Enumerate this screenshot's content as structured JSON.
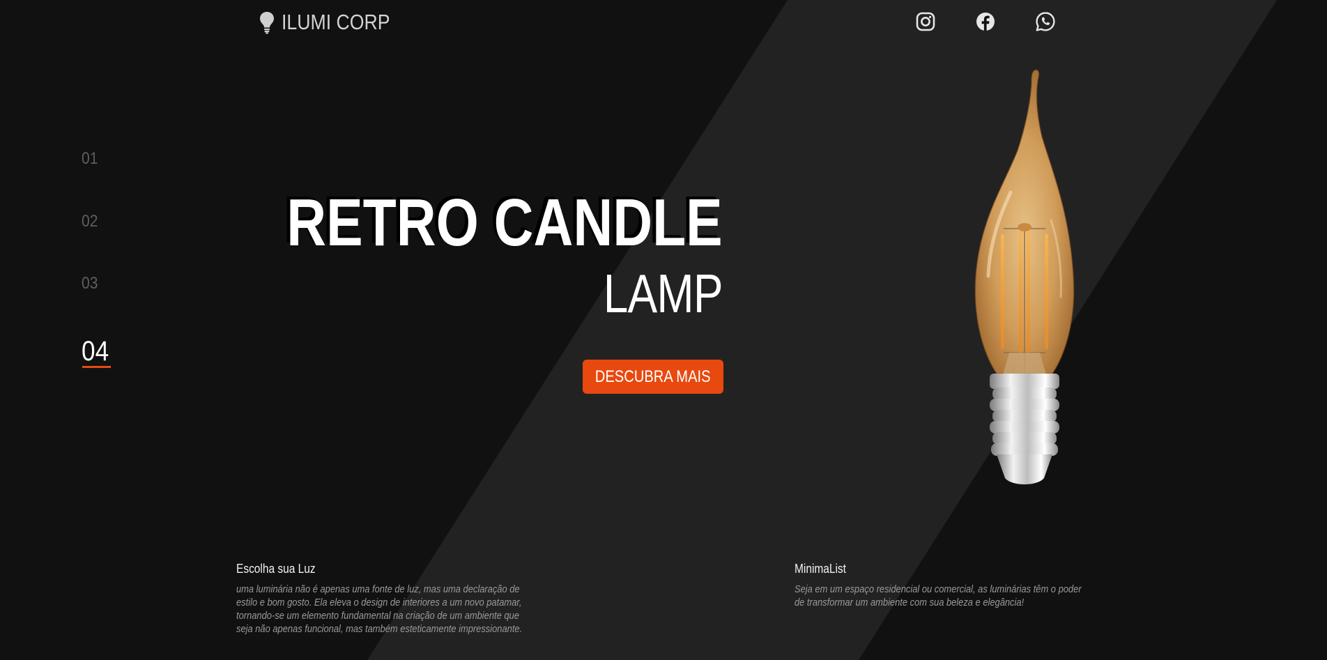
{
  "brand": {
    "name": "ILUMI CORP",
    "icon": "lightbulb-icon"
  },
  "social": [
    {
      "name": "instagram-icon"
    },
    {
      "name": "facebook-icon"
    },
    {
      "name": "whatsapp-icon"
    }
  ],
  "slides": {
    "items": [
      "01",
      "02",
      "03",
      "04"
    ],
    "active": "04"
  },
  "hero": {
    "title_line1": "RETRO CANDLE",
    "title_line2": "LAMP",
    "cta_label": "DESCUBRA MAIS"
  },
  "info_left": {
    "title": "Escolha sua Luz",
    "text": "uma luminária não é apenas uma fonte de luz, mas uma declaração de estilo e bom gosto. Ela eleva o design de interiores a um novo patamar, tornando-se um elemento fundamental na criação de um ambiente que seja não apenas funcional, mas também esteticamente impressionante."
  },
  "info_right": {
    "title": "MinimaList",
    "text": "Seja em um espaço residencial ou comercial, as luminárias têm o poder de transformar um ambiente com sua beleza e elegância!"
  },
  "colors": {
    "background": "#111111",
    "stripe": "#222222",
    "accent": "#e8490f",
    "text": "#ffffff",
    "muted": "#5e5e5e"
  }
}
